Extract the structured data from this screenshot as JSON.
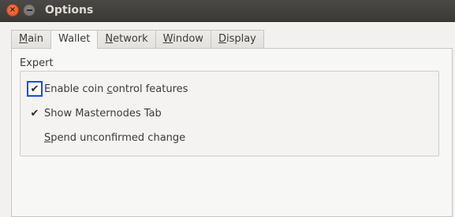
{
  "window": {
    "title": "Options",
    "close_glyph": "×"
  },
  "tabs": [
    {
      "label_pre": "",
      "label_ul": "M",
      "label_post": "ain",
      "active": false
    },
    {
      "label_pre": "",
      "label_ul": "W",
      "label_post": "allet",
      "active": true
    },
    {
      "label_pre": "",
      "label_ul": "N",
      "label_post": "etwork",
      "active": false
    },
    {
      "label_pre": "",
      "label_ul": "W",
      "label_post": "indow",
      "active": false
    },
    {
      "label_pre": "",
      "label_ul": "D",
      "label_post": "isplay",
      "active": false
    }
  ],
  "expert": {
    "group_label": "Expert",
    "options": [
      {
        "label_pre": "Enable coin ",
        "label_ul": "c",
        "label_post": "ontrol features",
        "checked": true,
        "focused": true,
        "check_glyph": "✔"
      },
      {
        "label_pre": "Show Masternodes Tab",
        "label_ul": "",
        "label_post": "",
        "checked": true,
        "focused": false,
        "check_glyph": "✔"
      },
      {
        "label_pre": "",
        "label_ul": "S",
        "label_post": "pend unconfirmed change",
        "checked": false,
        "focused": false,
        "check_glyph": ""
      }
    ]
  },
  "colors": {
    "focus_ring": "#1b4fd1",
    "close_button": "#e0531f",
    "titlebar": "#3b3a37"
  }
}
